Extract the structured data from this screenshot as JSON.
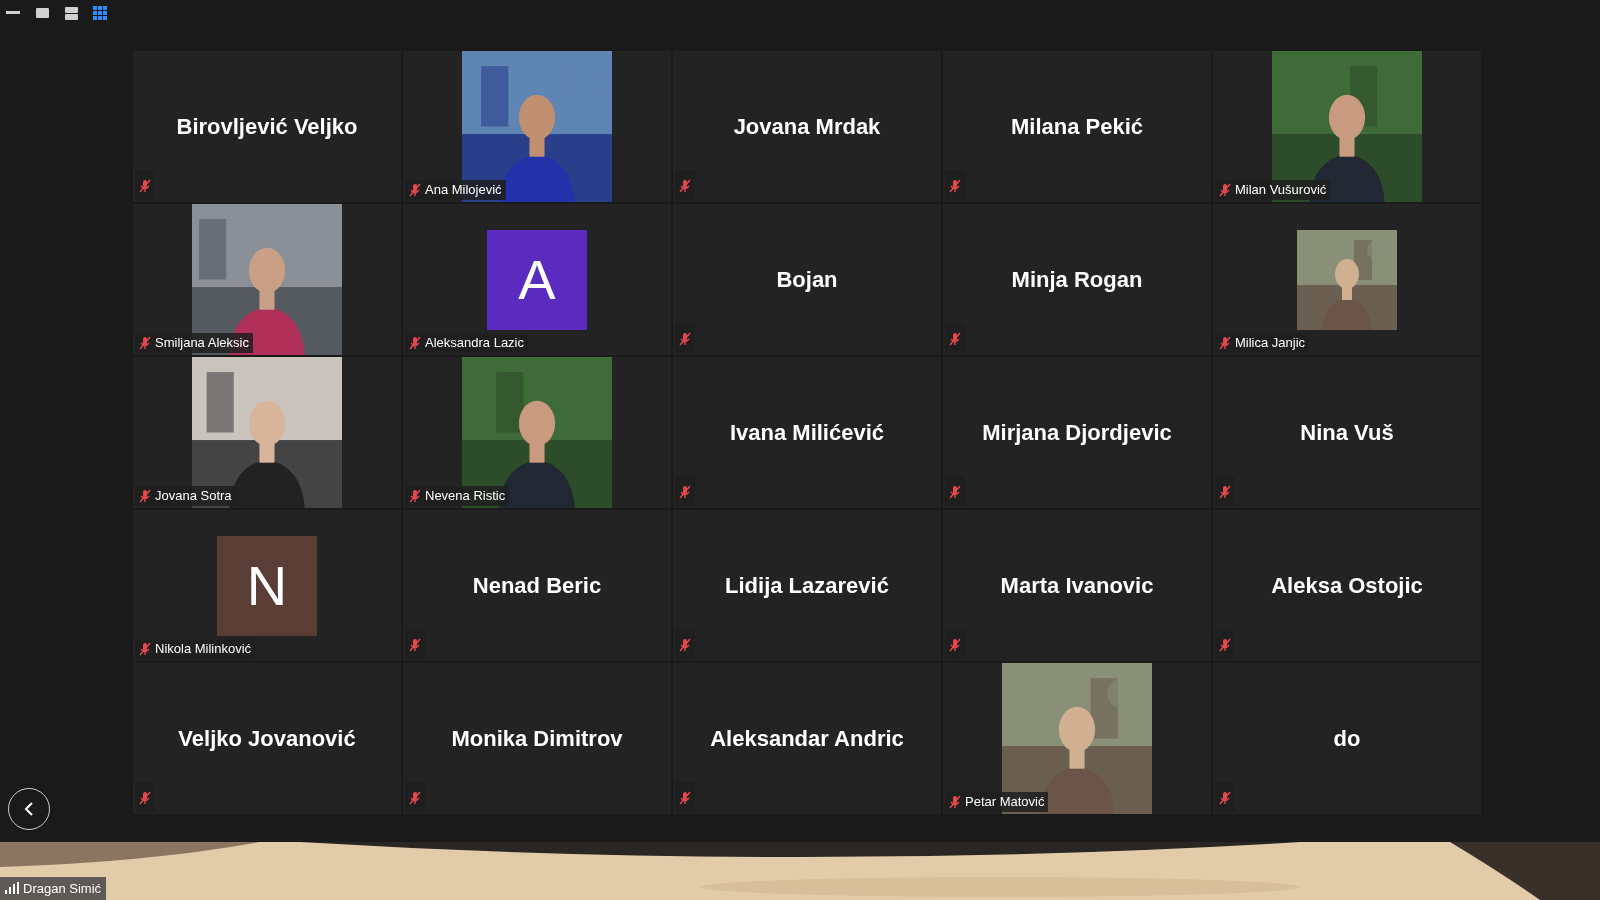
{
  "view_buttons": [
    {
      "kind": "minimize",
      "selected": false
    },
    {
      "kind": "single",
      "selected": false
    },
    {
      "kind": "split",
      "selected": false
    },
    {
      "kind": "gallery",
      "selected": true
    }
  ],
  "tiles": [
    {
      "kind": "name",
      "name": "Birovljević Veljko",
      "muted": true
    },
    {
      "kind": "video",
      "name": "Ana Milojević",
      "muted": true
    },
    {
      "kind": "name",
      "name": "Jovana Mrdak",
      "muted": true
    },
    {
      "kind": "name",
      "name": "Milana Pekić",
      "muted": true
    },
    {
      "kind": "video",
      "name": "Milan Vušurović",
      "muted": true
    },
    {
      "kind": "video",
      "name": "Smiljana Aleksic",
      "muted": true
    },
    {
      "kind": "avatar",
      "name": "Aleksandra Lazic",
      "letter": "A",
      "color": "#5b2bc0",
      "muted": true
    },
    {
      "kind": "name",
      "name": "Bojan",
      "muted": true
    },
    {
      "kind": "name",
      "name": "Minja Rogan",
      "muted": true
    },
    {
      "name": "Milica Janjic",
      "muted": true
    },
    {
      "kind": "video",
      "name": "Jovana Sotra",
      "muted": true
    },
    {
      "kind": "video",
      "name": "Nevena Ristic",
      "muted": true
    },
    {
      "kind": "name",
      "name": "Ivana Milićević",
      "muted": true
    },
    {
      "kind": "name",
      "name": "Mirjana Djordjevic",
      "muted": true
    },
    {
      "kind": "name",
      "name": "Nina Vuš",
      "muted": true
    },
    {
      "kind": "avatar",
      "name": "Nikola Milinković",
      "letter": "N",
      "color": "#5a3d35",
      "muted": true
    },
    {
      "kind": "name",
      "name": "Nenad Beric",
      "muted": true
    },
    {
      "kind": "name",
      "name": "Lidija Lazarević",
      "muted": true
    },
    {
      "kind": "name",
      "name": "Marta Ivanovic",
      "muted": true
    },
    {
      "kind": "name",
      "name": "Aleksa Ostojic",
      "muted": true
    },
    {
      "kind": "name",
      "name": "Veljko Jovanović",
      "muted": true
    },
    {
      "kind": "name",
      "name": "Monika Dimitrov",
      "muted": true
    },
    {
      "kind": "name",
      "name": "Aleksandar Andric",
      "muted": true
    },
    {
      "kind": "video",
      "name": "Petar Matović",
      "muted": true
    },
    {
      "kind": "name",
      "name": "do",
      "muted": true
    }
  ],
  "self_view": {
    "kind": "picture",
    "name": "Dragan Simić"
  }
}
